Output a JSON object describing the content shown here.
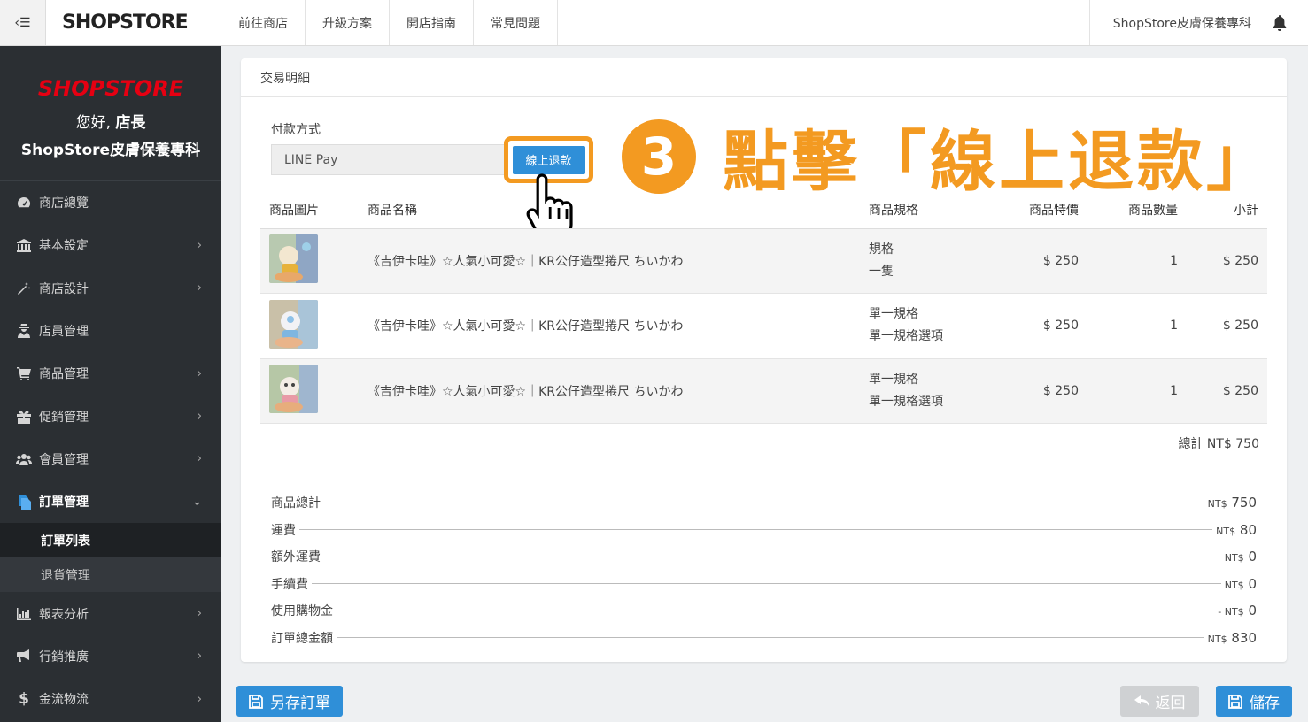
{
  "topbar": {
    "logo": "SHOPSTORE",
    "nav": [
      "前往商店",
      "升級方案",
      "開店指南",
      "常見問題"
    ],
    "store_name": "ShopStore皮膚保養專科"
  },
  "sidebar": {
    "logo": "SHOPSTORE",
    "greeting_prefix": "您好,",
    "greeting_role": "店長",
    "store_name": "ShopStore皮膚保養專科",
    "items": [
      {
        "label": "商店總覽",
        "icon": "dashboard-icon"
      },
      {
        "label": "基本設定",
        "icon": "bank-icon"
      },
      {
        "label": "商店設計",
        "icon": "magic-wand-icon"
      },
      {
        "label": "店員管理",
        "icon": "user-secret-icon"
      },
      {
        "label": "商品管理",
        "icon": "cart-icon"
      },
      {
        "label": "促銷管理",
        "icon": "gift-icon"
      },
      {
        "label": "會員管理",
        "icon": "users-icon"
      },
      {
        "label": "訂單管理",
        "icon": "orders-icon"
      },
      {
        "label": "報表分析",
        "icon": "bar-chart-icon"
      },
      {
        "label": "行銷推廣",
        "icon": "bullhorn-icon"
      },
      {
        "label": "金流物流",
        "icon": "dollar-icon"
      }
    ],
    "sub_items": [
      "訂單列表",
      "退貨管理"
    ]
  },
  "panel": {
    "title": "交易明細",
    "payment_label": "付款方式",
    "payment_value": "LINE Pay",
    "refund_button": "線上退款"
  },
  "callout": {
    "number": "3",
    "text": "點擊「線上退款」"
  },
  "table": {
    "headers": [
      "商品圖片",
      "商品名稱",
      "商品規格",
      "商品特價",
      "商品數量",
      "小計"
    ],
    "rows": [
      {
        "name": "《吉伊卡哇》☆人氣小可愛☆｜KR公仔造型捲尺 ちいかわ",
        "spec1": "規格",
        "spec2": "一隻",
        "price": "$ 250",
        "qty": "1",
        "subtotal": "$ 250"
      },
      {
        "name": "《吉伊卡哇》☆人氣小可愛☆｜KR公仔造型捲尺 ちいかわ",
        "spec1": "單一規格",
        "spec2": "單一規格選項",
        "price": "$ 250",
        "qty": "1",
        "subtotal": "$ 250"
      },
      {
        "name": "《吉伊卡哇》☆人氣小可愛☆｜KR公仔造型捲尺 ちいかわ",
        "spec1": "單一規格",
        "spec2": "單一規格選項",
        "price": "$ 250",
        "qty": "1",
        "subtotal": "$ 250"
      }
    ],
    "total": "總計 NT$ 750"
  },
  "summary": [
    {
      "label": "商品總計",
      "prefix": "NT$",
      "value": "750"
    },
    {
      "label": "運費",
      "prefix": "NT$",
      "value": "80"
    },
    {
      "label": "額外運費",
      "prefix": "NT$",
      "value": "0"
    },
    {
      "label": "手續費",
      "prefix": "NT$",
      "value": "0"
    },
    {
      "label": "使用購物金",
      "prefix": "- NT$",
      "value": "0"
    },
    {
      "label": "訂單總金額",
      "prefix": "NT$",
      "value": "830"
    }
  ],
  "buttons": {
    "save_as": "另存訂單",
    "back": "返回",
    "save": "儲存"
  },
  "colors": {
    "accent": "#2f8fd8",
    "callout": "#f39a21",
    "sidebar": "#2b2f33",
    "brand_red": "#e60012"
  }
}
